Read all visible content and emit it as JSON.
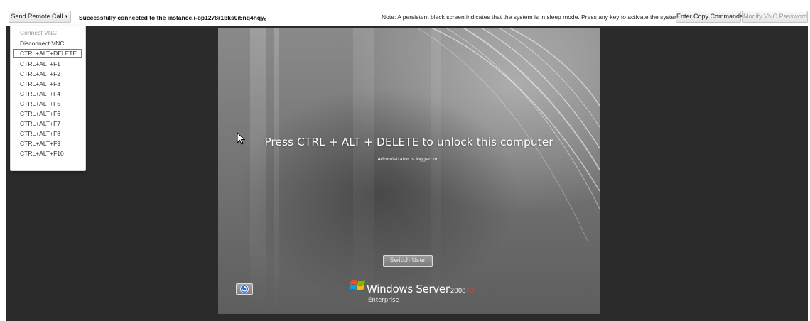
{
  "toolbar": {
    "send_remote_call_label": "Send Remote Call",
    "status_message": "Successfully connected to the instance.i-bp1278r1bks0i5nq4hqy。",
    "note": "Note: A persistent black screen indicates that the system is in sleep mode. Press any key to activate the system.",
    "enter_copy_commands_label": "Enter Copy Commands",
    "modify_vnc_password_label": "Modify VNC Password"
  },
  "dropdown": {
    "items": [
      {
        "label": "Connect VNC",
        "disabled": true
      },
      {
        "label": "Disconnect VNC",
        "disabled": false
      },
      {
        "label": "CTRL+ALT+DELETE",
        "disabled": false,
        "highlighted": true
      },
      {
        "label": "CTRL+ALT+F1",
        "disabled": false
      },
      {
        "label": "CTRL+ALT+F2",
        "disabled": false
      },
      {
        "label": "CTRL+ALT+F3",
        "disabled": false
      },
      {
        "label": "CTRL+ALT+F4",
        "disabled": false
      },
      {
        "label": "CTRL+ALT+F5",
        "disabled": false
      },
      {
        "label": "CTRL+ALT+F6",
        "disabled": false
      },
      {
        "label": "CTRL+ALT+F7",
        "disabled": false
      },
      {
        "label": "CTRL+ALT+F8",
        "disabled": false
      },
      {
        "label": "CTRL+ALT+F9",
        "disabled": false
      },
      {
        "label": "CTRL+ALT+F10",
        "disabled": false
      }
    ]
  },
  "lock_screen": {
    "title": "Press CTRL + ALT + DELETE to unlock this computer",
    "subtitle": "Administrator is logged on.",
    "switch_user_label": "Switch User",
    "brand_name": "Windows Server",
    "brand_version": "2008",
    "brand_release": "R2",
    "brand_edition": "Enterprise"
  },
  "colors": {
    "highlight_border": "#e4572e",
    "screen_background": "#2b2b2b"
  }
}
